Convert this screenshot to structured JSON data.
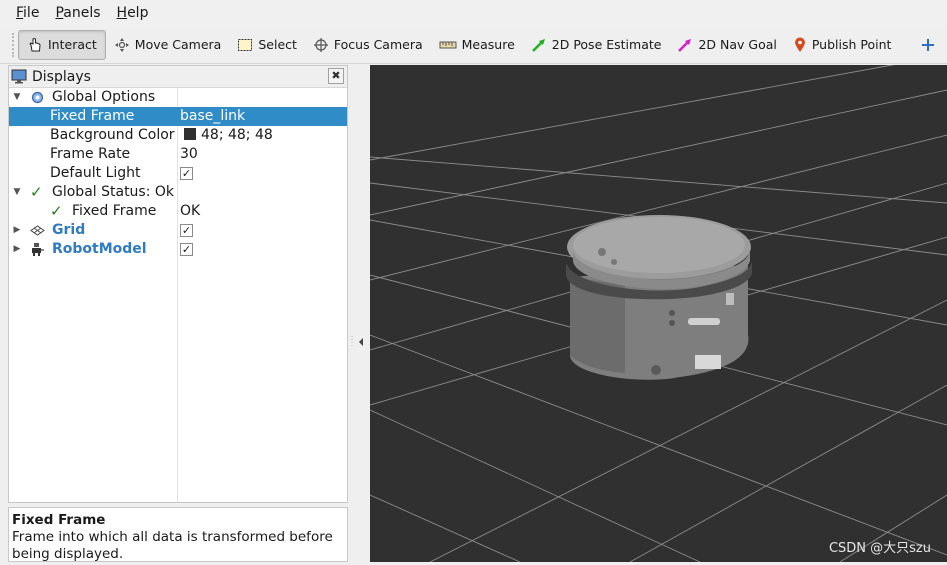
{
  "menubar": {
    "items": [
      {
        "first": "F",
        "rest": "ile"
      },
      {
        "first": "P",
        "rest": "anels"
      },
      {
        "first": "H",
        "rest": "elp"
      }
    ]
  },
  "toolbar": {
    "interact": "Interact",
    "move_camera": "Move Camera",
    "select": "Select",
    "focus_camera": "Focus Camera",
    "measure": "Measure",
    "pose_estimate": "2D Pose Estimate",
    "nav_goal": "2D Nav Goal",
    "publish_point": "Publish Point",
    "add_icon": "plus-icon",
    "remove_icon": "minus-icon"
  },
  "displays": {
    "title": "Displays",
    "close_label": "✖",
    "rows": [
      {
        "name": "Global Options",
        "value": ""
      },
      {
        "name": "Fixed Frame",
        "value": "base_link"
      },
      {
        "name": "Background Color",
        "value": "48; 48; 48"
      },
      {
        "name": "Frame Rate",
        "value": "30"
      },
      {
        "name": "Default Light",
        "value": "✓"
      },
      {
        "name": "Global Status: Ok",
        "value": ""
      },
      {
        "name": "Fixed Frame",
        "value": "OK"
      },
      {
        "name": "Grid",
        "value": "✓"
      },
      {
        "name": "RobotModel",
        "value": "✓"
      }
    ]
  },
  "description": {
    "title": "Fixed Frame",
    "text": "Frame into which all data is transformed before being displayed."
  },
  "viewport": {
    "background_color": "#303030",
    "watermark": "CSDN @大只szu"
  },
  "colors": {
    "selection": "#308cc6",
    "link_blue": "#2f7bc2",
    "status_ok_green": "#1e7d1e"
  }
}
